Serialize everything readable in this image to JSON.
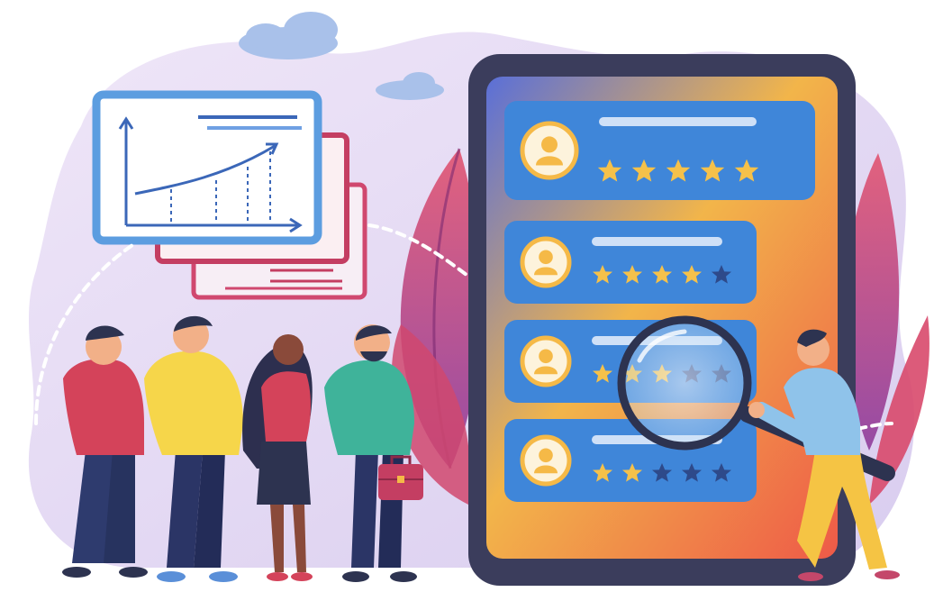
{
  "illustration": {
    "colors": {
      "background_blob": "#ece3f6",
      "cloud": "#a9c1ea",
      "tablet_body": "#3b3d5c",
      "screen_top": "#4a7ed8",
      "screen_bottom": "#f06a4a",
      "card_blue": "#3f86d9",
      "card_border": "#f5b947",
      "star_filled": "#f5c14a",
      "star_empty": "#2e4a8a",
      "chart_frame": "#5c9de0",
      "leaf": "#c24a7a"
    },
    "review_cards": [
      {
        "rating": 5,
        "max_rating": 5
      },
      {
        "rating": 4,
        "max_rating": 5
      },
      {
        "rating": 3,
        "max_rating": 5
      },
      {
        "rating": 2,
        "max_rating": 5
      }
    ],
    "people_count": 5,
    "icons": [
      "user-avatar-icon",
      "star-icon",
      "magnifying-glass-icon",
      "briefcase-icon",
      "growth-chart-icon"
    ]
  }
}
